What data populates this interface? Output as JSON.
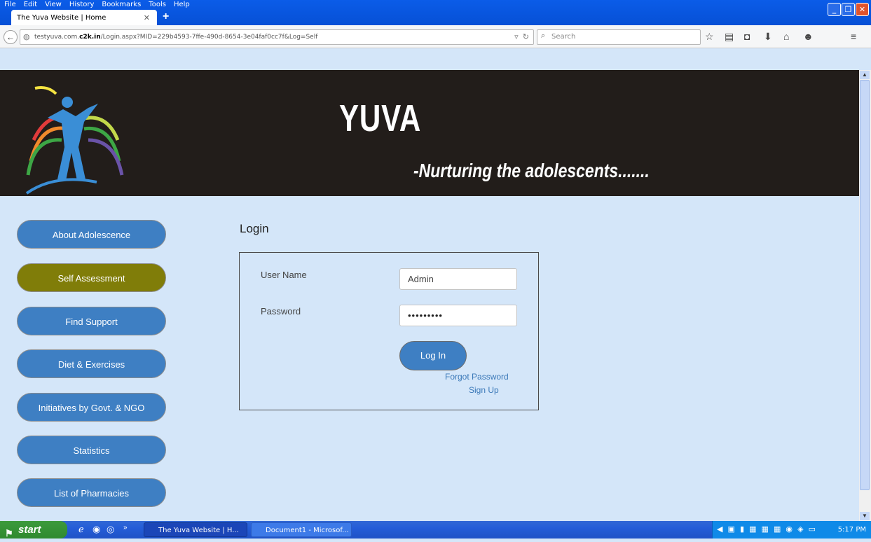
{
  "browser": {
    "menu": [
      "File",
      "Edit",
      "View",
      "History",
      "Bookmarks",
      "Tools",
      "Help"
    ],
    "tab_title": "The Yuva Website | Home",
    "url_prefix": "testyuva.com.",
    "url_domain": "c2k.in",
    "url_rest": "/Login.aspx?MID=229b4593-7ffe-490d-8654-3e04faf0cc7f&Log=Self",
    "search_placeholder": "Search"
  },
  "header": {
    "title": "YUVA",
    "tagline": "-Nurturing the adolescents......."
  },
  "sidebar": {
    "active_color": "#807d09",
    "items": [
      {
        "label": "About Adolescence"
      },
      {
        "label": "Self Assessment"
      },
      {
        "label": "Find Support"
      },
      {
        "label": "Diet & Exercises"
      },
      {
        "label": "Initiatives by Govt. & NGO"
      },
      {
        "label": "Statistics"
      },
      {
        "label": "List of Pharmacies"
      }
    ]
  },
  "login": {
    "heading": "Login",
    "username_label": "User Name",
    "username_value": "Admin",
    "password_label": "Password",
    "password_value": "•••••••••",
    "login_button": "Log In",
    "forgot_password": "Forgot Password",
    "sign_up": "Sign Up"
  },
  "taskbar": {
    "start_label": "start",
    "tasks": [
      {
        "label": "The Yuva Website | H..."
      },
      {
        "label": "Document1 - Microsof..."
      }
    ],
    "clock": "5:17 PM"
  }
}
